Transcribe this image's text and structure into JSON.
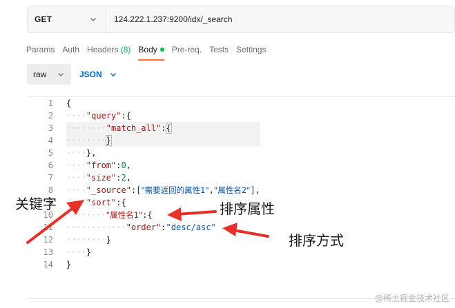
{
  "request": {
    "method": "GET",
    "url": "124.222.1.237:9200/idx/_search"
  },
  "tabs": [
    {
      "label": "Params"
    },
    {
      "label": "Auth"
    },
    {
      "label": "Headers",
      "count": "(8)"
    },
    {
      "label": "Body",
      "active": true
    },
    {
      "label": "Pre-req."
    },
    {
      "label": "Tests"
    },
    {
      "label": "Settings"
    }
  ],
  "body_type": {
    "mode": "raw",
    "language": "JSON"
  },
  "editor": {
    "line_numbers": [
      "1",
      "2",
      "3",
      "4",
      "5",
      "6",
      "7",
      "8",
      "9",
      "10",
      "11",
      "12",
      "13",
      "14"
    ],
    "lines": [
      {
        "indent": "",
        "tokens": [
          {
            "t": "{",
            "c": "p"
          }
        ]
      },
      {
        "indent": "····",
        "tokens": [
          {
            "t": "\"query\"",
            "c": "key"
          },
          {
            "t": ":{",
            "c": "p"
          }
        ]
      },
      {
        "indent": "········",
        "tokens": [
          {
            "t": "\"match_all\"",
            "c": "key"
          },
          {
            "t": ":",
            "c": "p"
          },
          {
            "t": "{",
            "c": "box"
          }
        ]
      },
      {
        "indent": "········",
        "tokens": [
          {
            "t": "}",
            "c": "box"
          }
        ]
      },
      {
        "indent": "····",
        "tokens": [
          {
            "t": "},",
            "c": "p"
          }
        ]
      },
      {
        "indent": "····",
        "tokens": [
          {
            "t": "\"from\"",
            "c": "key"
          },
          {
            "t": ":",
            "c": "p"
          },
          {
            "t": "0",
            "c": "num"
          },
          {
            "t": ",",
            "c": "p"
          }
        ]
      },
      {
        "indent": "····",
        "tokens": [
          {
            "t": "\"size\"",
            "c": "key"
          },
          {
            "t": ":",
            "c": "p"
          },
          {
            "t": "2",
            "c": "num"
          },
          {
            "t": ",",
            "c": "p"
          }
        ]
      },
      {
        "indent": "····",
        "tokens": [
          {
            "t": "\"_source\"",
            "c": "key"
          },
          {
            "t": ":[",
            "c": "p"
          },
          {
            "t": "\"需要返回的属性1\"",
            "c": "strcjk"
          },
          {
            "t": ",",
            "c": "p"
          },
          {
            "t": "\"属性名2\"",
            "c": "strcjk"
          },
          {
            "t": "],",
            "c": "p"
          }
        ]
      },
      {
        "indent": "····",
        "tokens": [
          {
            "t": "\"sort\"",
            "c": "key"
          },
          {
            "t": ":{",
            "c": "p"
          }
        ]
      },
      {
        "indent": "········",
        "tokens": [
          {
            "t": "\"属性名1\"",
            "c": "keycjk"
          },
          {
            "t": ":{",
            "c": "p"
          }
        ]
      },
      {
        "indent": "············",
        "tokens": [
          {
            "t": "\"order\"",
            "c": "key"
          },
          {
            "t": ":",
            "c": "p"
          },
          {
            "t": "\"desc/asc\"",
            "c": "str"
          }
        ]
      },
      {
        "indent": "········",
        "tokens": [
          {
            "t": "}",
            "c": "p"
          }
        ]
      },
      {
        "indent": "····",
        "tokens": [
          {
            "t": "}",
            "c": "p"
          }
        ]
      },
      {
        "indent": "",
        "tokens": [
          {
            "t": "}",
            "c": "p"
          }
        ]
      }
    ]
  },
  "annotations": {
    "keyword": "关键字",
    "sort_attribute": "排序属性",
    "sort_method": "排序方式",
    "arrow_color": "#e8302a"
  },
  "watermark": "@稀土掘金技术社区",
  "icons": {
    "method_dropdown": "chevron-down-icon",
    "raw_dropdown": "chevron-down-icon",
    "json_dropdown": "chevron-down-icon",
    "body_indicator": "status-dot-icon"
  },
  "colors": {
    "active_tab_underline": "#ff6c37",
    "body_dot": "#0cbb52",
    "json_label": "#0265d2",
    "json_key": "#a31515",
    "json_number": "#098658",
    "json_string": "#0451a5"
  }
}
